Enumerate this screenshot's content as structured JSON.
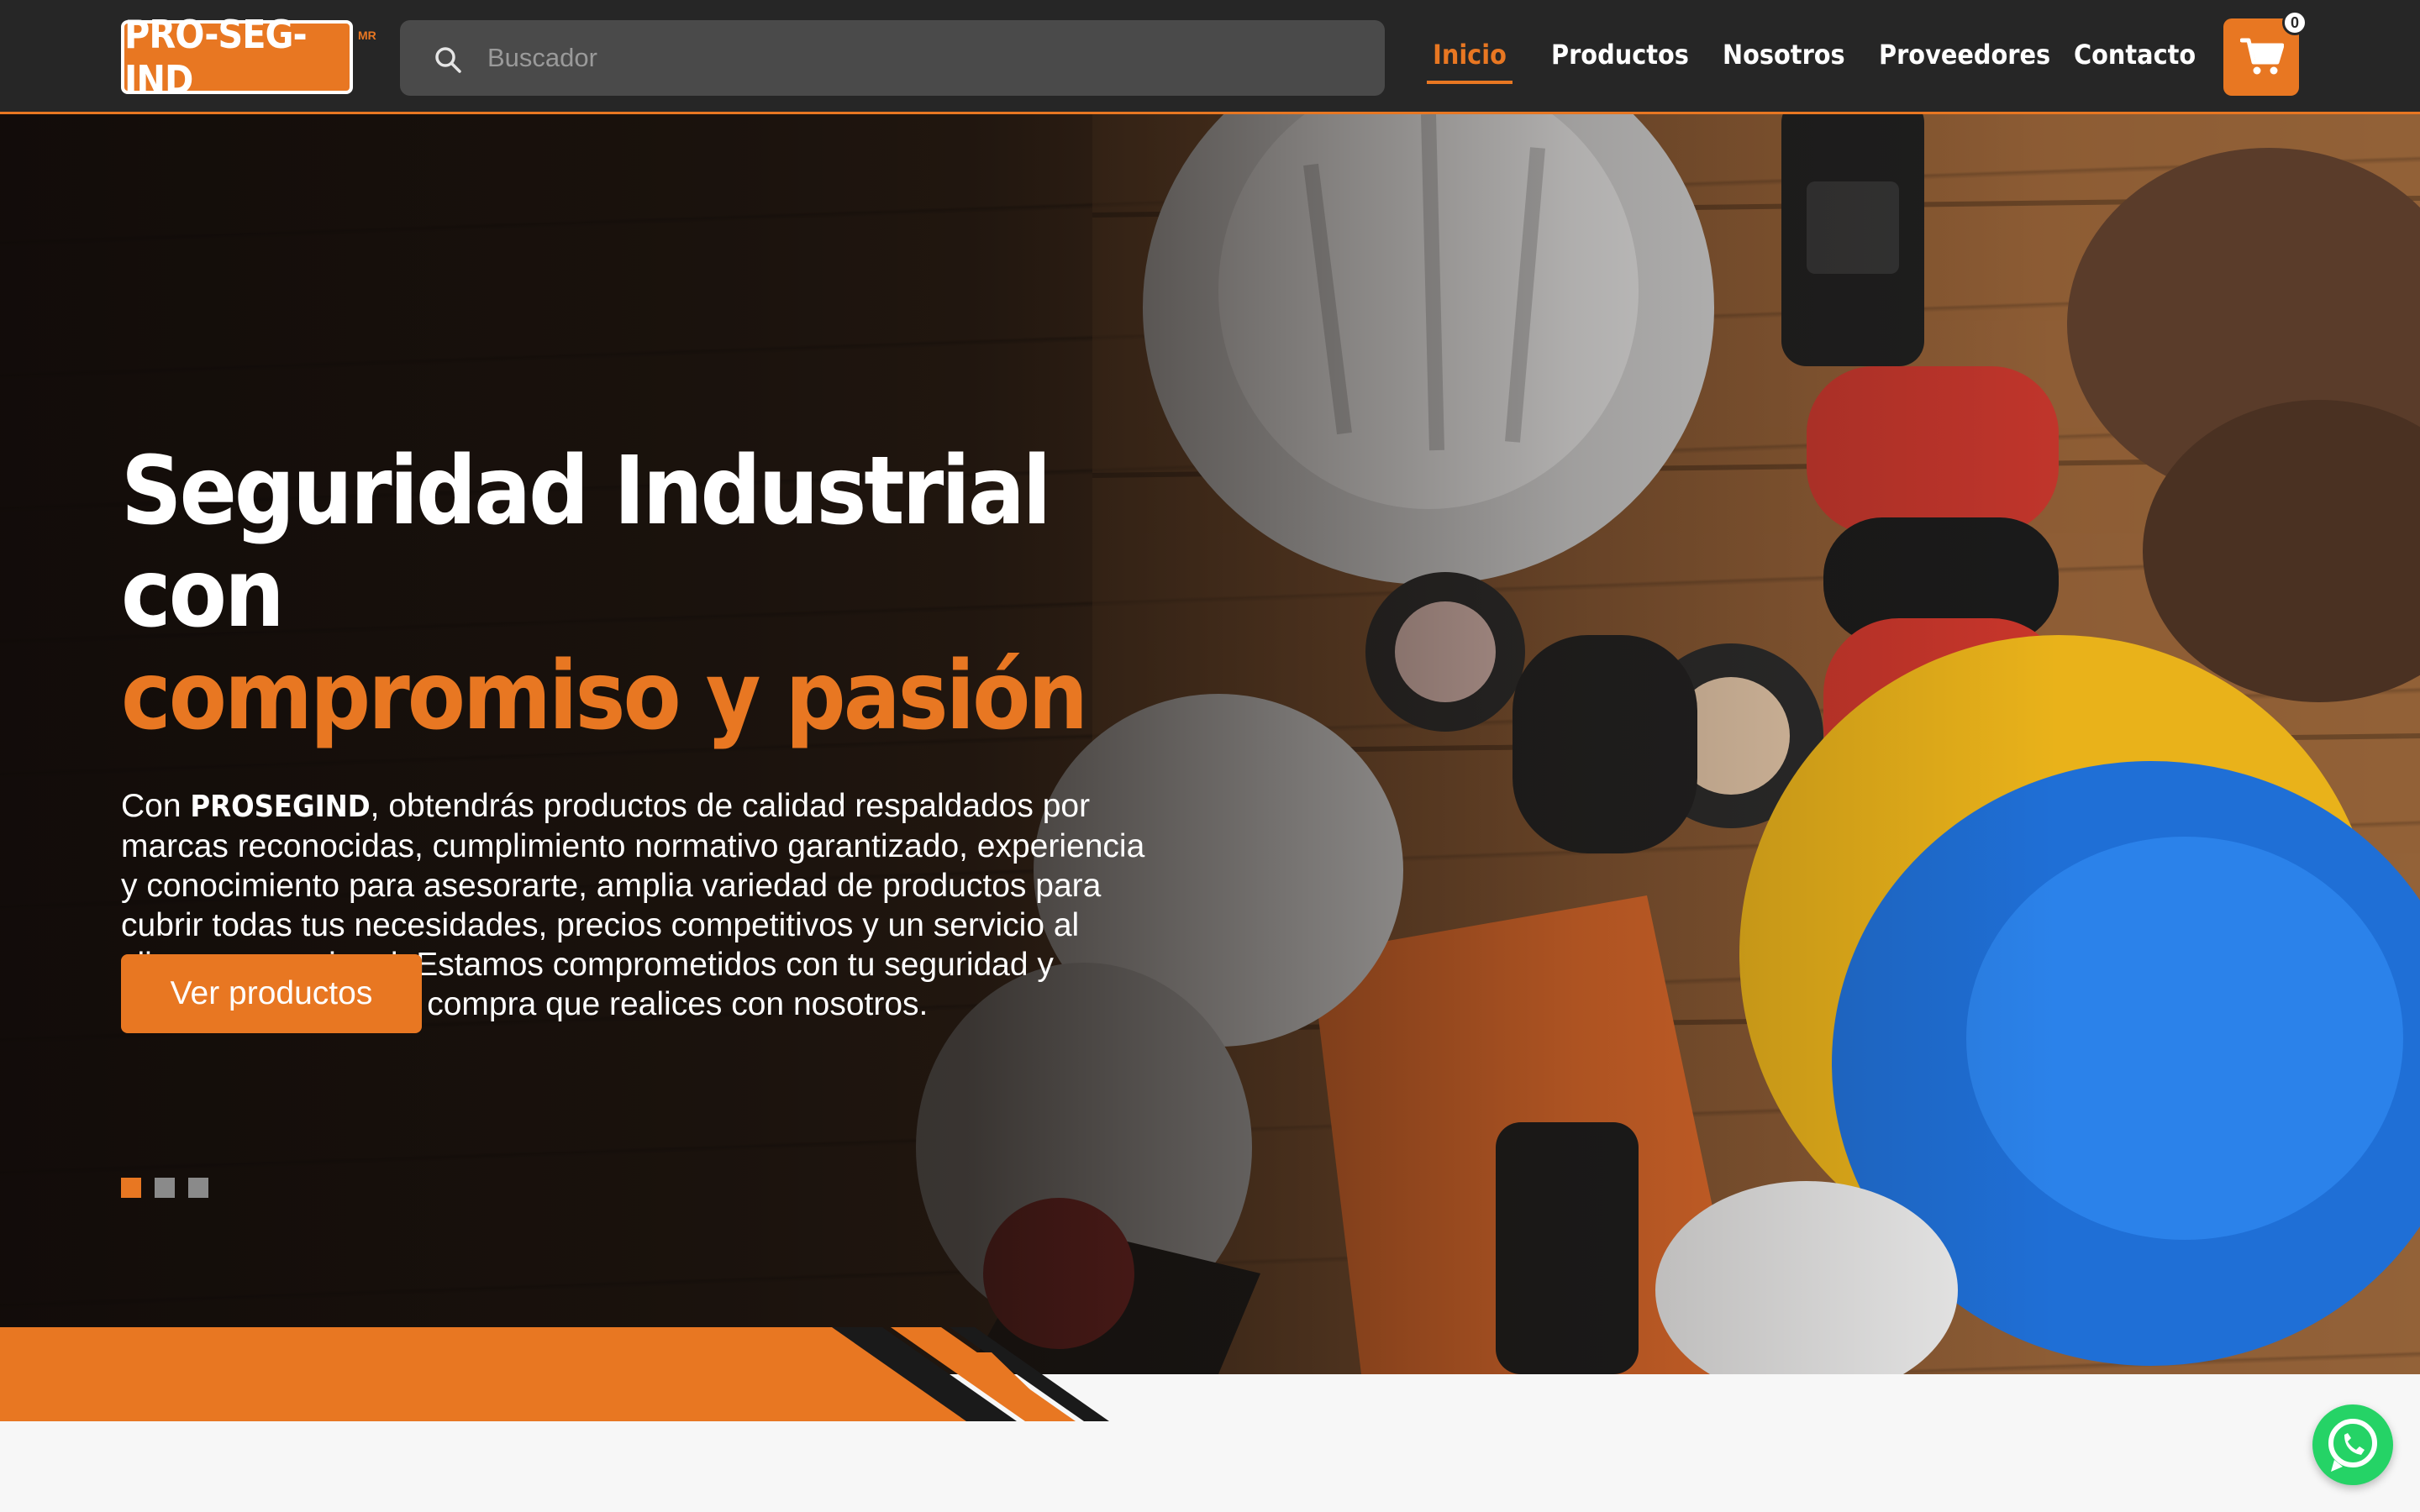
{
  "brand": {
    "logo_text": "PRO-SEG-IND",
    "logo_mark": "MR"
  },
  "search": {
    "placeholder": "Buscador"
  },
  "nav": {
    "items": [
      "Inicio",
      "Productos",
      "Nosotros",
      "Proveedores",
      "Contacto"
    ],
    "active": "Inicio"
  },
  "cart": {
    "count": "0",
    "icon": "cart-icon"
  },
  "hero": {
    "title_line1": "Seguridad Industrial con",
    "title_line2": "compromiso y pasión",
    "text_prefix": "Con ",
    "text_brand": "PROSEGIND",
    "text_body": ", obtendrás productos de calidad respaldados por marcas reconocidas, cumplimiento normativo garantizado, experiencia y conocimiento para asesorarte, amplia variedad de productos para cubrir todas tus necesidades, precios competitivos y un servicio al cliente excepcional. Estamos comprometidos con tu seguridad y satisfacción en cada compra que realices con nosotros.",
    "cta_label": "Ver productos",
    "slides_total": 3,
    "slide_active": 1
  },
  "widgets": {
    "chat_icon": "whatsapp-icon"
  },
  "colors": {
    "accent": "#e87722",
    "header_bg": "#262626",
    "search_bg": "#4a4a4a"
  }
}
